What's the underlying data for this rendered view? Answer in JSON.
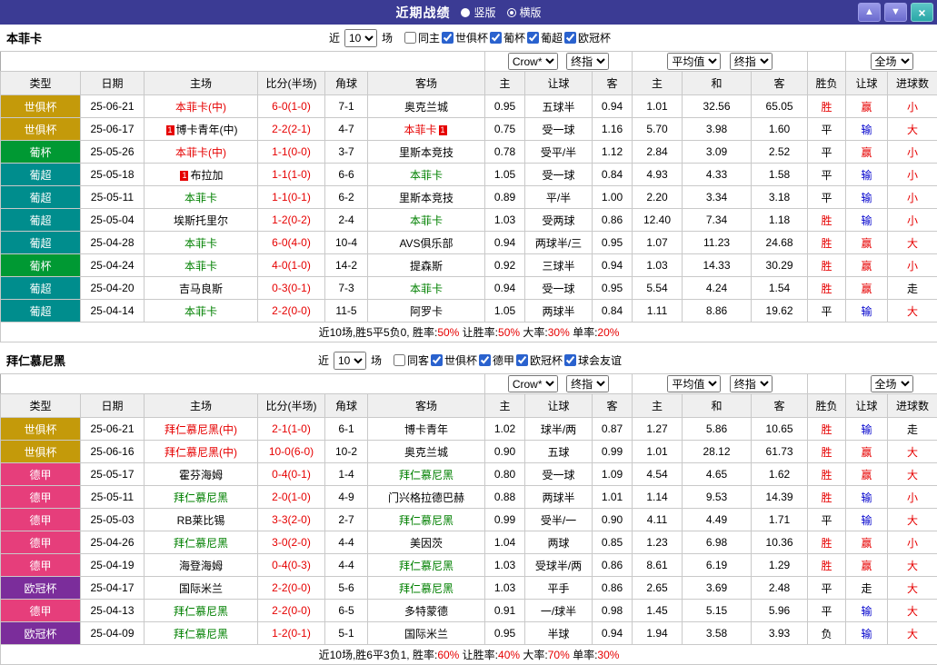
{
  "titlebar": {
    "title": "近期战绩",
    "options": [
      {
        "label": "竖版",
        "selected": false
      },
      {
        "label": "横版",
        "selected": true
      }
    ],
    "buttons": {
      "up": "▲",
      "down": "▼",
      "close": "×"
    }
  },
  "columns": [
    "类型",
    "日期",
    "主场",
    "比分(半场)",
    "角球",
    "客场",
    "主",
    "让球",
    "客",
    "主",
    "和",
    "客",
    "胜负",
    "让球",
    "进球数"
  ],
  "palette": {
    "red": "#E60000",
    "green": "#008000",
    "blue": "#0000CC",
    "black": "#000000"
  },
  "league_colors": {
    "世俱杯": "#C49A0A",
    "葡杯": "#009933",
    "葡超": "#008D8D",
    "德甲": "#E63E7B",
    "欧冠杯": "#7B2D9B"
  },
  "ui_colors": {
    "titlebar_bg": "#3B3B94",
    "nav_button_bg": "#6A6ACE",
    "close_button_bg": "#2AA7A7",
    "header_row_bg": "#EFEFEF",
    "grid_border": "#C9C9C9",
    "checkbox_accent": "#2A62CE",
    "bottom_rule": "#333333"
  },
  "sections": [
    {
      "team": "本菲卡",
      "filter": {
        "prefix": "近",
        "count": "10",
        "suffix": "场",
        "same_venue": {
          "label": "同主",
          "checked": false
        },
        "leagues": [
          {
            "label": "世俱杯",
            "checked": true
          },
          {
            "label": "葡杯",
            "checked": true
          },
          {
            "label": "葡超",
            "checked": true
          },
          {
            "label": "欧冠杯",
            "checked": true
          }
        ]
      },
      "dropdowns": {
        "odds_source": "Crow*",
        "odds_stage": "终指",
        "average": "平均值",
        "average_stage": "终指",
        "scope": "全场"
      },
      "rows": [
        {
          "league": "世俱杯",
          "date": "25-06-21",
          "home": {
            "text": "本菲卡(中)",
            "color": "red"
          },
          "score": "6-0(1-0)",
          "corners": "7-1",
          "away": {
            "text": "奥克兰城",
            "color": "black"
          },
          "ah": [
            "0.95",
            "五球半",
            "0.94"
          ],
          "eu": [
            "1.01",
            "32.56",
            "65.05"
          ],
          "result": {
            "text": "胜",
            "color": "red"
          },
          "handicap": {
            "text": "赢",
            "color": "red"
          },
          "goals": {
            "text": "小",
            "color": "red"
          }
        },
        {
          "league": "世俱杯",
          "date": "25-06-17",
          "home": {
            "card": "1",
            "text": "博卡青年(中)",
            "color": "black"
          },
          "score": "2-2(2-1)",
          "corners": "4-7",
          "away": {
            "text": "本菲卡",
            "color": "red",
            "card": "1"
          },
          "ah": [
            "0.75",
            "受一球",
            "1.16"
          ],
          "eu": [
            "5.70",
            "3.98",
            "1.60"
          ],
          "result": {
            "text": "平",
            "color": "black"
          },
          "handicap": {
            "text": "输",
            "color": "blue"
          },
          "goals": {
            "text": "大",
            "color": "red"
          }
        },
        {
          "league": "葡杯",
          "date": "25-05-26",
          "home": {
            "text": "本菲卡(中)",
            "color": "red"
          },
          "score": "1-1(0-0)",
          "corners": "3-7",
          "away": {
            "text": "里斯本竞技",
            "color": "black"
          },
          "ah": [
            "0.78",
            "受平/半",
            "1.12"
          ],
          "eu": [
            "2.84",
            "3.09",
            "2.52"
          ],
          "result": {
            "text": "平",
            "color": "black"
          },
          "handicap": {
            "text": "赢",
            "color": "red"
          },
          "goals": {
            "text": "小",
            "color": "red"
          }
        },
        {
          "league": "葡超",
          "date": "25-05-18",
          "home": {
            "card": "1",
            "text": "布拉加",
            "color": "black"
          },
          "score": "1-1(1-0)",
          "corners": "6-6",
          "away": {
            "text": "本菲卡",
            "color": "green"
          },
          "ah": [
            "1.05",
            "受一球",
            "0.84"
          ],
          "eu": [
            "4.93",
            "4.33",
            "1.58"
          ],
          "result": {
            "text": "平",
            "color": "black"
          },
          "handicap": {
            "text": "输",
            "color": "blue"
          },
          "goals": {
            "text": "小",
            "color": "red"
          }
        },
        {
          "league": "葡超",
          "date": "25-05-11",
          "home": {
            "text": "本菲卡",
            "color": "green"
          },
          "score": "1-1(0-1)",
          "corners": "6-2",
          "away": {
            "text": "里斯本竞技",
            "color": "black"
          },
          "ah": [
            "0.89",
            "平/半",
            "1.00"
          ],
          "eu": [
            "2.20",
            "3.34",
            "3.18"
          ],
          "result": {
            "text": "平",
            "color": "black"
          },
          "handicap": {
            "text": "输",
            "color": "blue"
          },
          "goals": {
            "text": "小",
            "color": "red"
          }
        },
        {
          "league": "葡超",
          "date": "25-05-04",
          "home": {
            "text": "埃斯托里尔",
            "color": "black"
          },
          "score": "1-2(0-2)",
          "corners": "2-4",
          "away": {
            "text": "本菲卡",
            "color": "green"
          },
          "ah": [
            "1.03",
            "受两球",
            "0.86"
          ],
          "eu": [
            "12.40",
            "7.34",
            "1.18"
          ],
          "result": {
            "text": "胜",
            "color": "red"
          },
          "handicap": {
            "text": "输",
            "color": "blue"
          },
          "goals": {
            "text": "小",
            "color": "red"
          }
        },
        {
          "league": "葡超",
          "date": "25-04-28",
          "home": {
            "text": "本菲卡",
            "color": "green"
          },
          "score": "6-0(4-0)",
          "corners": "10-4",
          "away": {
            "text": "AVS俱乐部",
            "color": "black"
          },
          "ah": [
            "0.94",
            "两球半/三",
            "0.95"
          ],
          "eu": [
            "1.07",
            "11.23",
            "24.68"
          ],
          "result": {
            "text": "胜",
            "color": "red"
          },
          "handicap": {
            "text": "赢",
            "color": "red"
          },
          "goals": {
            "text": "大",
            "color": "red"
          }
        },
        {
          "league": "葡杯",
          "date": "25-04-24",
          "home": {
            "text": "本菲卡",
            "color": "green"
          },
          "score": "4-0(1-0)",
          "corners": "14-2",
          "away": {
            "text": "提森斯",
            "color": "black"
          },
          "ah": [
            "0.92",
            "三球半",
            "0.94"
          ],
          "eu": [
            "1.03",
            "14.33",
            "30.29"
          ],
          "result": {
            "text": "胜",
            "color": "red"
          },
          "handicap": {
            "text": "赢",
            "color": "red"
          },
          "goals": {
            "text": "小",
            "color": "red"
          }
        },
        {
          "league": "葡超",
          "date": "25-04-20",
          "home": {
            "text": "吉马良斯",
            "color": "black"
          },
          "score": "0-3(0-1)",
          "corners": "7-3",
          "away": {
            "text": "本菲卡",
            "color": "green"
          },
          "ah": [
            "0.94",
            "受一球",
            "0.95"
          ],
          "eu": [
            "5.54",
            "4.24",
            "1.54"
          ],
          "result": {
            "text": "胜",
            "color": "red"
          },
          "handicap": {
            "text": "赢",
            "color": "red"
          },
          "goals": {
            "text": "走",
            "color": "black"
          }
        },
        {
          "league": "葡超",
          "date": "25-04-14",
          "home": {
            "text": "本菲卡",
            "color": "green"
          },
          "score": "2-2(0-0)",
          "corners": "11-5",
          "away": {
            "text": "阿罗卡",
            "color": "black"
          },
          "ah": [
            "1.05",
            "两球半",
            "0.84"
          ],
          "eu": [
            "1.11",
            "8.86",
            "19.62"
          ],
          "result": {
            "text": "平",
            "color": "black"
          },
          "handicap": {
            "text": "输",
            "color": "blue"
          },
          "goals": {
            "text": "大",
            "color": "red"
          }
        }
      ],
      "summary": [
        {
          "text": "近10场,胜5平5负0, 胜率:",
          "color": "black"
        },
        {
          "text": "50%",
          "color": "red"
        },
        {
          "text": " 让胜率:",
          "color": "black"
        },
        {
          "text": "50%",
          "color": "red"
        },
        {
          "text": " 大率:",
          "color": "black"
        },
        {
          "text": "30%",
          "color": "red"
        },
        {
          "text": " 单率:",
          "color": "black"
        },
        {
          "text": "20%",
          "color": "red"
        }
      ]
    },
    {
      "team": "拜仁慕尼黑",
      "filter": {
        "prefix": "近",
        "count": "10",
        "suffix": "场",
        "same_venue": {
          "label": "同客",
          "checked": false
        },
        "leagues": [
          {
            "label": "世俱杯",
            "checked": true
          },
          {
            "label": "德甲",
            "checked": true
          },
          {
            "label": "欧冠杯",
            "checked": true
          },
          {
            "label": "球会友谊",
            "checked": true
          }
        ]
      },
      "dropdowns": {
        "odds_source": "Crow*",
        "odds_stage": "终指",
        "average": "平均值",
        "average_stage": "终指",
        "scope": "全场"
      },
      "rows": [
        {
          "league": "世俱杯",
          "date": "25-06-21",
          "home": {
            "text": "拜仁慕尼黑(中)",
            "color": "red"
          },
          "score": "2-1(1-0)",
          "corners": "6-1",
          "away": {
            "text": "博卡青年",
            "color": "black"
          },
          "ah": [
            "1.02",
            "球半/两",
            "0.87"
          ],
          "eu": [
            "1.27",
            "5.86",
            "10.65"
          ],
          "result": {
            "text": "胜",
            "color": "red"
          },
          "handicap": {
            "text": "输",
            "color": "blue"
          },
          "goals": {
            "text": "走",
            "color": "black"
          }
        },
        {
          "league": "世俱杯",
          "date": "25-06-16",
          "home": {
            "text": "拜仁慕尼黑(中)",
            "color": "red"
          },
          "score": "10-0(6-0)",
          "corners": "10-2",
          "away": {
            "text": "奥克兰城",
            "color": "black"
          },
          "ah": [
            "0.90",
            "五球",
            "0.99"
          ],
          "eu": [
            "1.01",
            "28.12",
            "61.73"
          ],
          "result": {
            "text": "胜",
            "color": "red"
          },
          "handicap": {
            "text": "赢",
            "color": "red"
          },
          "goals": {
            "text": "大",
            "color": "red"
          }
        },
        {
          "league": "德甲",
          "date": "25-05-17",
          "home": {
            "text": "霍芬海姆",
            "color": "black"
          },
          "score": "0-4(0-1)",
          "corners": "1-4",
          "away": {
            "text": "拜仁慕尼黑",
            "color": "green"
          },
          "ah": [
            "0.80",
            "受一球",
            "1.09"
          ],
          "eu": [
            "4.54",
            "4.65",
            "1.62"
          ],
          "result": {
            "text": "胜",
            "color": "red"
          },
          "handicap": {
            "text": "赢",
            "color": "red"
          },
          "goals": {
            "text": "大",
            "color": "red"
          }
        },
        {
          "league": "德甲",
          "date": "25-05-11",
          "home": {
            "text": "拜仁慕尼黑",
            "color": "green"
          },
          "score": "2-0(1-0)",
          "corners": "4-9",
          "away": {
            "text": "门兴格拉德巴赫",
            "color": "black"
          },
          "ah": [
            "0.88",
            "两球半",
            "1.01"
          ],
          "eu": [
            "1.14",
            "9.53",
            "14.39"
          ],
          "result": {
            "text": "胜",
            "color": "red"
          },
          "handicap": {
            "text": "输",
            "color": "blue"
          },
          "goals": {
            "text": "小",
            "color": "red"
          }
        },
        {
          "league": "德甲",
          "date": "25-05-03",
          "home": {
            "text": "RB莱比锡",
            "color": "black"
          },
          "score": "3-3(2-0)",
          "corners": "2-7",
          "away": {
            "text": "拜仁慕尼黑",
            "color": "green"
          },
          "ah": [
            "0.99",
            "受半/一",
            "0.90"
          ],
          "eu": [
            "4.11",
            "4.49",
            "1.71"
          ],
          "result": {
            "text": "平",
            "color": "black"
          },
          "handicap": {
            "text": "输",
            "color": "blue"
          },
          "goals": {
            "text": "大",
            "color": "red"
          }
        },
        {
          "league": "德甲",
          "date": "25-04-26",
          "home": {
            "text": "拜仁慕尼黑",
            "color": "green"
          },
          "score": "3-0(2-0)",
          "corners": "4-4",
          "away": {
            "text": "美因茨",
            "color": "black"
          },
          "ah": [
            "1.04",
            "两球",
            "0.85"
          ],
          "eu": [
            "1.23",
            "6.98",
            "10.36"
          ],
          "result": {
            "text": "胜",
            "color": "red"
          },
          "handicap": {
            "text": "赢",
            "color": "red"
          },
          "goals": {
            "text": "小",
            "color": "red"
          }
        },
        {
          "league": "德甲",
          "date": "25-04-19",
          "home": {
            "text": "海登海姆",
            "color": "black"
          },
          "score": "0-4(0-3)",
          "corners": "4-4",
          "away": {
            "text": "拜仁慕尼黑",
            "color": "green"
          },
          "ah": [
            "1.03",
            "受球半/两",
            "0.86"
          ],
          "eu": [
            "8.61",
            "6.19",
            "1.29"
          ],
          "result": {
            "text": "胜",
            "color": "red"
          },
          "handicap": {
            "text": "赢",
            "color": "red"
          },
          "goals": {
            "text": "大",
            "color": "red"
          }
        },
        {
          "league": "欧冠杯",
          "date": "25-04-17",
          "home": {
            "text": "国际米兰",
            "color": "black"
          },
          "score": "2-2(0-0)",
          "corners": "5-6",
          "away": {
            "text": "拜仁慕尼黑",
            "color": "green"
          },
          "ah": [
            "1.03",
            "平手",
            "0.86"
          ],
          "eu": [
            "2.65",
            "3.69",
            "2.48"
          ],
          "result": {
            "text": "平",
            "color": "black"
          },
          "handicap": {
            "text": "走",
            "color": "black"
          },
          "goals": {
            "text": "大",
            "color": "red"
          }
        },
        {
          "league": "德甲",
          "date": "25-04-13",
          "home": {
            "text": "拜仁慕尼黑",
            "color": "green"
          },
          "score": "2-2(0-0)",
          "corners": "6-5",
          "away": {
            "text": "多特蒙德",
            "color": "black"
          },
          "ah": [
            "0.91",
            "一/球半",
            "0.98"
          ],
          "eu": [
            "1.45",
            "5.15",
            "5.96"
          ],
          "result": {
            "text": "平",
            "color": "black"
          },
          "handicap": {
            "text": "输",
            "color": "blue"
          },
          "goals": {
            "text": "大",
            "color": "red"
          }
        },
        {
          "league": "欧冠杯",
          "date": "25-04-09",
          "home": {
            "text": "拜仁慕尼黑",
            "color": "green"
          },
          "score": "1-2(0-1)",
          "corners": "5-1",
          "away": {
            "text": "国际米兰",
            "color": "black"
          },
          "ah": [
            "0.95",
            "半球",
            "0.94"
          ],
          "eu": [
            "1.94",
            "3.58",
            "3.93"
          ],
          "result": {
            "text": "负",
            "color": "black"
          },
          "handicap": {
            "text": "输",
            "color": "blue"
          },
          "goals": {
            "text": "大",
            "color": "red"
          }
        }
      ],
      "summary": [
        {
          "text": "近10场,胜6平3负1, 胜率:",
          "color": "black"
        },
        {
          "text": "60%",
          "color": "red"
        },
        {
          "text": " 让胜率:",
          "color": "black"
        },
        {
          "text": "40%",
          "color": "red"
        },
        {
          "text": " 大率:",
          "color": "black"
        },
        {
          "text": "70%",
          "color": "red"
        },
        {
          "text": " 单率:",
          "color": "black"
        },
        {
          "text": "30%",
          "color": "red"
        }
      ]
    }
  ]
}
